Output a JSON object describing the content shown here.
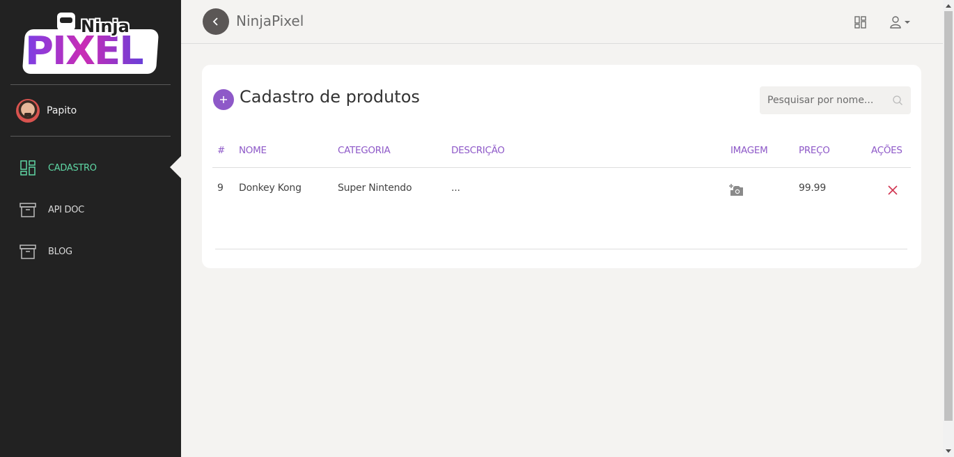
{
  "app": {
    "title": "NinjaPixel"
  },
  "logo": {
    "top_text": "Ninja",
    "main_text": "PIXEL"
  },
  "sidebar": {
    "user_name": "Papito",
    "items": [
      {
        "label": "CADASTRO",
        "icon": "dashboard-icon",
        "active": true
      },
      {
        "label": "API DOC",
        "icon": "archive-box-icon",
        "active": false
      },
      {
        "label": "BLOG",
        "icon": "archive-box-icon",
        "active": false
      }
    ]
  },
  "card": {
    "title": "Cadastro de produtos",
    "search_placeholder": "Pesquisar por nome...",
    "columns": [
      "#",
      "NOME",
      "CATEGORIA",
      "DESCRIÇÃO",
      "IMAGEM",
      "PREÇO",
      "AÇÕES"
    ],
    "rows": [
      {
        "id": "9",
        "name": "Donkey Kong",
        "category": "Super Nintendo",
        "description": "...",
        "price": "99.99"
      }
    ]
  },
  "colors": {
    "accent": "#8e59c8",
    "active_nav": "#5fd8a5",
    "delete": "#d0334f",
    "sidebar_bg": "#222222"
  }
}
